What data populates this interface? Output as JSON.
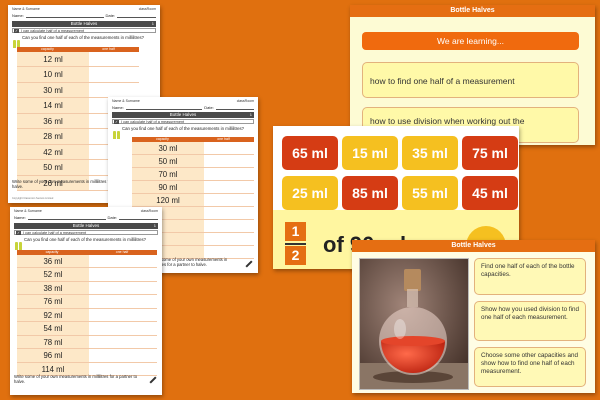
{
  "worksheets": {
    "meta_left": "Name & Surname",
    "meta_right": "classRoom",
    "name_label": "Name:",
    "date_label": "Date:",
    "title": "Bottle Halves",
    "number": "1",
    "objective": "I can calculate half of a measurement",
    "question": "Can you find one half of each of the measurements in millilitres?",
    "col_capacity": "capacity",
    "col_half": "one half",
    "footer": "Write some of your own measurements in millilitres for a partner to halve.",
    "copyright": "Copyright Classroom Secrets Limited",
    "sheet1_values": [
      "12 ml",
      "10 ml",
      "30 ml",
      "14 ml",
      "36 ml",
      "28 ml",
      "42 ml",
      "50 ml",
      "26 ml"
    ],
    "sheet2_values": [
      "30 ml",
      "50 ml",
      "70 ml",
      "90 ml",
      "120 ml",
      "",
      "",
      "",
      ""
    ],
    "sheet3_values": [
      "36 ml",
      "52 ml",
      "38 ml",
      "76 ml",
      "92 ml",
      "54 ml",
      "78 ml",
      "96 ml",
      "114 ml"
    ]
  },
  "slide_learning": {
    "title": "Bottle Halves",
    "banner": "We are learning...",
    "item1": "how to find one half of a measurement",
    "item2": "how to use division when working out the"
  },
  "slide_tiles": {
    "tiles": [
      {
        "label": "65 ml",
        "color": "red"
      },
      {
        "label": "15 ml",
        "color": "yellow"
      },
      {
        "label": "35 ml",
        "color": "yellow"
      },
      {
        "label": "75 ml",
        "color": "red"
      },
      {
        "label": "25 ml",
        "color": "yellow"
      },
      {
        "label": "85 ml",
        "color": "red"
      },
      {
        "label": "55 ml",
        "color": "yellow"
      },
      {
        "label": "45 ml",
        "color": "red"
      }
    ],
    "numerator": "1",
    "denominator": "2",
    "of_text": "of 90 ml"
  },
  "slide_task": {
    "title": "Bottle Halves",
    "card1": "Find one half of each of the bottle capacities.",
    "card2": "Show how you used division to find one half of each measurement.",
    "card3": "Choose some other capacities and show how to find one half of each measurement."
  },
  "colors": {
    "background": "#e0700f",
    "orange": "#e56e12",
    "red_tile": "#d53c14",
    "yellow_tile": "#f5c020",
    "card_yellow": "#fff9b6"
  }
}
